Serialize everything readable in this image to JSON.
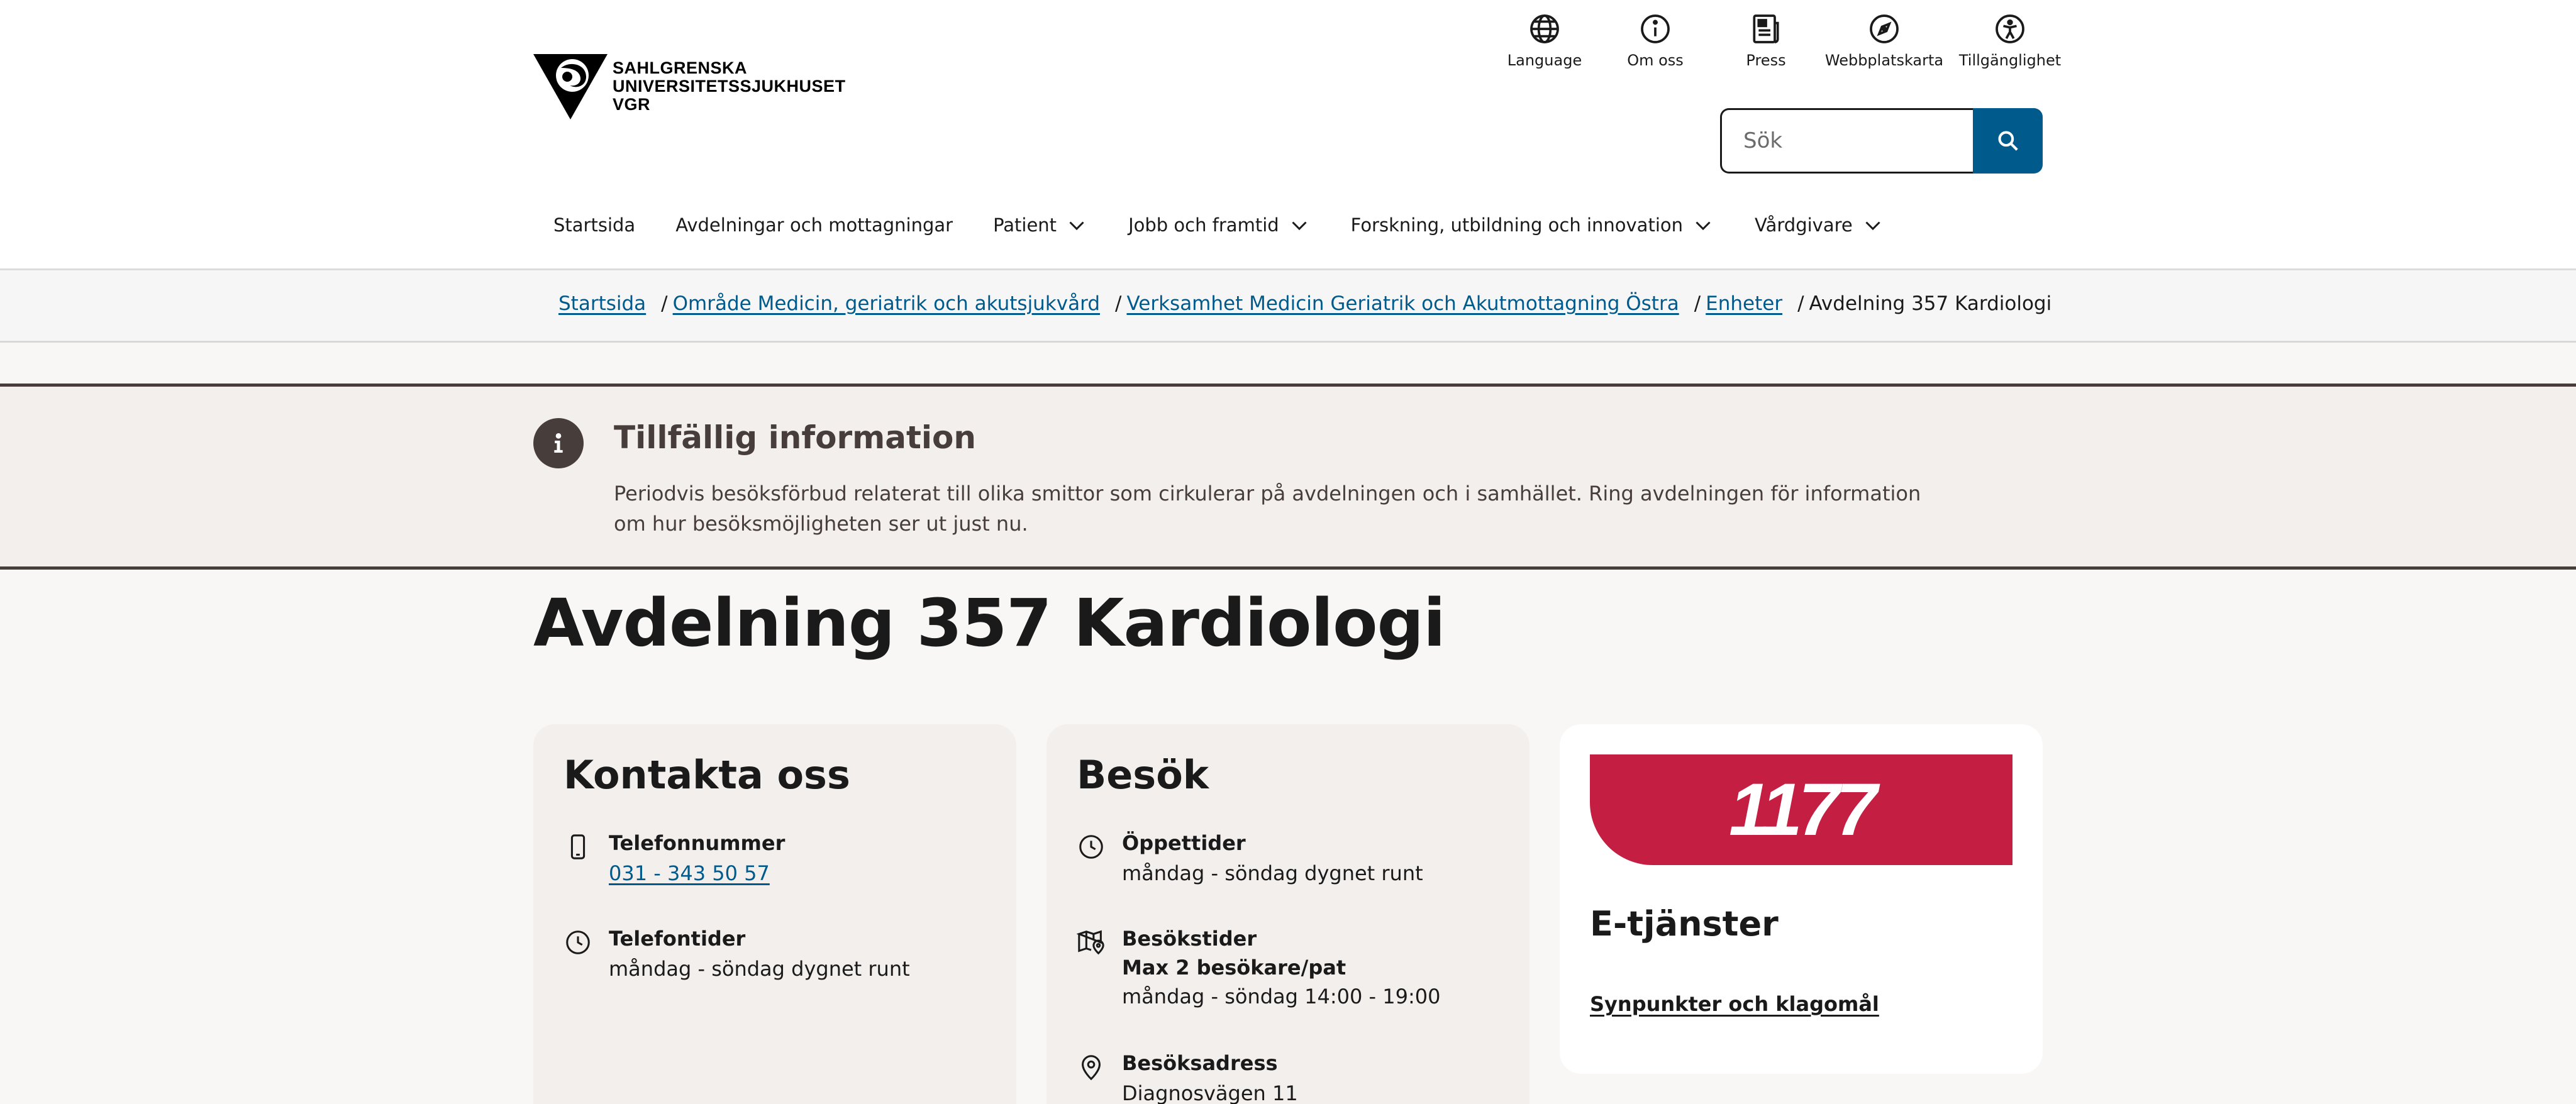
{
  "logo": {
    "line1": "SAHLGRENSKA",
    "line2": "UNIVERSITETSSJUKHUSET",
    "line3": "VGR"
  },
  "utility": [
    {
      "label": "Language",
      "icon": "globe-icon"
    },
    {
      "label": "Om oss",
      "icon": "info-circle-icon"
    },
    {
      "label": "Press",
      "icon": "newspaper-icon"
    },
    {
      "label": "Webbplatskarta",
      "icon": "compass-icon"
    },
    {
      "label": "Tillgänglighet",
      "icon": "accessibility-icon"
    }
  ],
  "search": {
    "placeholder": "Sök",
    "value": ""
  },
  "nav": [
    {
      "label": "Startsida"
    },
    {
      "label": "Avdelningar och mottagningar"
    },
    {
      "label": "Patient"
    },
    {
      "label": "Jobb och framtid"
    },
    {
      "label": "Forskning, utbildning och innovation"
    },
    {
      "label": "Vårdgivare"
    }
  ],
  "breadcrumb": {
    "items": [
      "Startsida",
      "Område Medicin, geriatrik och akutsjukvård",
      "Verksamhet Medicin Geriatrik och Akutmottagning Östra",
      "Enheter"
    ],
    "current": "Avdelning 357 Kardiologi",
    "separator": "/"
  },
  "info": {
    "title": "Tillfällig information",
    "text": "Periodvis besöksförbud relaterat till olika smittor som cirkulerar på avdelningen och i samhället. Ring avdelningen för information om hur besöksmöjligheten ser ut just nu."
  },
  "page_title": "Avdelning 357 Kardiologi",
  "contact": {
    "title": "Kontakta oss",
    "phone_label": "Telefonnummer",
    "phone_value": "031 - 343 50 57",
    "hours_label": "Telefontider",
    "hours_value": "måndag - söndag dygnet runt"
  },
  "visit": {
    "title": "Besök",
    "open_label": "Öppettider",
    "open_value": "måndag - söndag dygnet runt",
    "visit_label": "Besökstider",
    "visit_rule": "Max 2 besökare/pat",
    "visit_value": "måndag - söndag 14:00 - 19:00",
    "address_label": "Besöksadress",
    "address_value": "Diagnosvägen 11"
  },
  "eservices": {
    "brand": "1177",
    "title": "E-tjänster",
    "link": "Synpunkter och klagomål"
  },
  "colors": {
    "primary": "#005a8c",
    "info_brown": "#473d3a",
    "brand_1177": "#c41f42"
  }
}
